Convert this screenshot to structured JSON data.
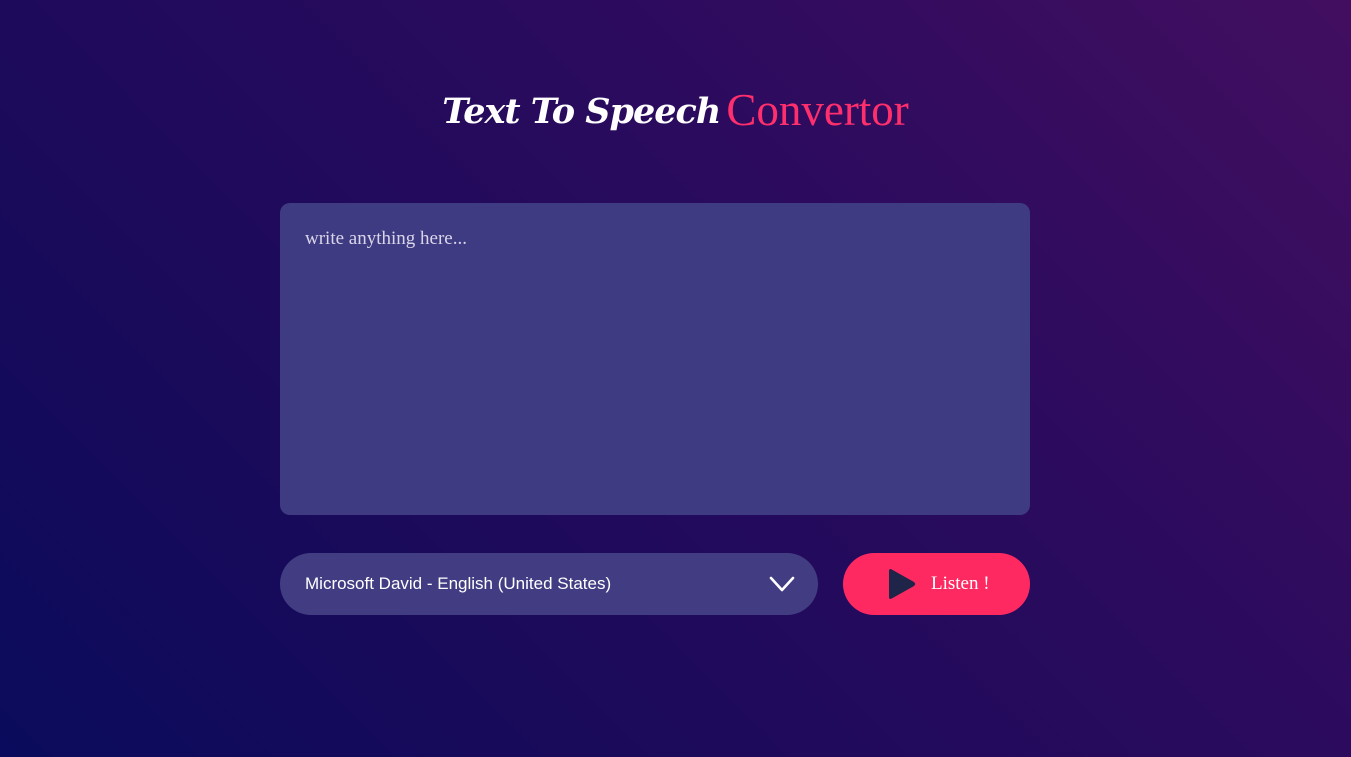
{
  "header": {
    "title_main": "Text To Speech",
    "title_accent": "Convertor"
  },
  "editor": {
    "placeholder": "write anything here...",
    "value": ""
  },
  "voice_select": {
    "selected": "Microsoft David - English (United States)",
    "icon": "chevron-down-icon"
  },
  "listen_button": {
    "label": "Listen !",
    "icon": "play-icon"
  },
  "colors": {
    "accent": "#ff2e6c",
    "panel": "#3f3b82",
    "button": "#ff2962",
    "play_icon": "#1f2548"
  }
}
